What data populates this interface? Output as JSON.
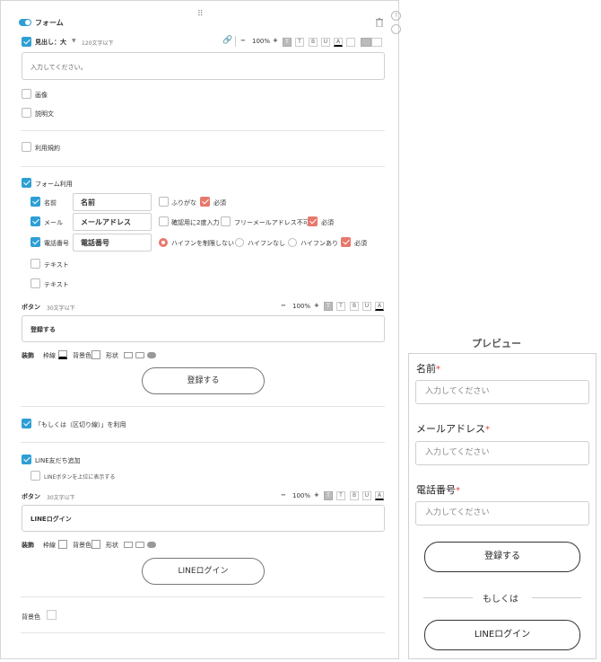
{
  "form_panel": {
    "title": "フォーム",
    "heading": {
      "label": "見出し：大",
      "hint": "120文字以下",
      "zoom": "100%",
      "placeholder": "入力してください。"
    },
    "fmt": {
      "t1": "T",
      "t2": "T",
      "b": "B",
      "u": "U",
      "a": "A",
      "minus": "−",
      "plus": "+"
    },
    "image_label": "画像",
    "desc_label": "説明文",
    "terms_label": "利用規約",
    "form_use_label": "フォーム利用",
    "fields": {
      "name": {
        "label": "名前",
        "value": "名前",
        "furigana": "ふりがな",
        "required": "必須"
      },
      "mail": {
        "label": "メール",
        "value": "メールアドレス",
        "confirm": "確認用に2度入力",
        "free": "フリーメールアドレス不可",
        "required": "必須"
      },
      "tel": {
        "label": "電話番号",
        "value": "電話番号",
        "opt1": "ハイフンを制限しない",
        "opt2": "ハイフンなし",
        "opt3": "ハイフンあり",
        "required": "必須"
      },
      "text1": "テキスト",
      "text2": "テキスト"
    },
    "button1": {
      "label": "ボタン",
      "hint": "30文字以下",
      "zoom": "100%",
      "value": "登録する",
      "deco_label": "装飾",
      "border_label": "枠線",
      "bg_label": "背景色",
      "shape_label": "形状",
      "preview": "登録する"
    },
    "or_label": "「もしくは（区切り線）」を利用",
    "line": {
      "label": "LINE友だち追加",
      "top_label": "LINEボタンを上位に表示する",
      "button_label": "ボタン",
      "hint": "30文字以下",
      "zoom": "100%",
      "value": "LINEログイン",
      "deco_label": "装飾",
      "border_label": "枠線",
      "bg_label": "背景色",
      "shape_label": "形状",
      "preview": "LINEログイン"
    },
    "bg_label": "背景色"
  },
  "preview": {
    "title": "プレビュー",
    "name_label": "名前",
    "mail_label": "メールアドレス",
    "tel_label": "電話番号",
    "req": "*",
    "placeholder": "入力してください",
    "submit": "登録する",
    "or": "もしくは",
    "line": "LINEログイン"
  },
  "colors": {
    "accent": "#2d9fd4",
    "required": "#e8786c",
    "required_mark": "#e0463b"
  }
}
